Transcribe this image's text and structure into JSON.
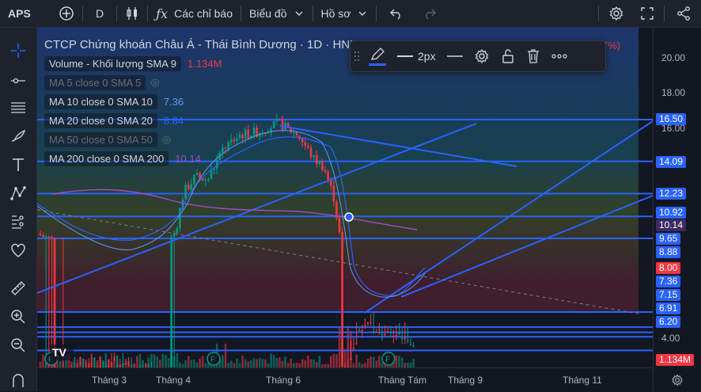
{
  "topbar": {
    "symbol": "APS",
    "interval": "D",
    "indicators_label": "Các chỉ báo",
    "layout_label": "Biểu đồ",
    "profile_label": "Hồ sơ"
  },
  "sidebar": {
    "tools": [
      "crosshair-icon",
      "horizontal-ray-icon",
      "lines-icon",
      "brush-icon",
      "text-icon",
      "pattern-icon",
      "prediction-icon",
      "heart-icon",
      "ruler-icon",
      "zoom-in-icon",
      "zoom-out-icon",
      "magnet-icon"
    ]
  },
  "legend": {
    "title": "CTCP Chứng khoán Châu Á - Thái Bình Dương · 1D · HNX",
    "change": "7%)",
    "volume_label": "Volume - Khối lượng SMA 9",
    "volume_value": "1.134M",
    "ma5_label": "MA 5 close 0 SMA 5",
    "ma10_label": "MA 10 close 0 SMA 10",
    "ma10_value": "7.36",
    "ma20_label": "MA 20 close 0 SMA 20",
    "ma20_value": "8.84",
    "ma50_label": "MA 50 close 0 SMA 50",
    "ma200_label": "MA 200 close 0 SMA 200",
    "ma200_value": "10.14"
  },
  "floatbar": {
    "width_label": "2px"
  },
  "price_axis": {
    "ticks": [
      "20.00",
      "18.00",
      "16.00",
      "4.00"
    ],
    "labels": [
      {
        "text": "16.50",
        "color": "#2962ff"
      },
      {
        "text": "14.09",
        "color": "#2962ff"
      },
      {
        "text": "12.23",
        "color": "#2962ff"
      },
      {
        "text": "10.92",
        "color": "#2962ff"
      },
      {
        "text": "10.14",
        "color": "#3d2a63"
      },
      {
        "text": "9.65",
        "color": "#2962ff"
      },
      {
        "text": "8.88",
        "color": "#2962ff"
      },
      {
        "text": "8.00",
        "color": "#f23645"
      },
      {
        "text": "7.36",
        "color": "#2962ff"
      },
      {
        "text": "7.15",
        "color": "#2962ff"
      },
      {
        "text": "6.91",
        "color": "#2962ff"
      },
      {
        "text": "6.20",
        "color": "#2962ff"
      },
      {
        "text": "1.134M",
        "color": "#f23645"
      }
    ]
  },
  "time_axis": {
    "ticks": [
      "Tháng 3",
      "Tháng 4",
      "Tháng 6",
      "Tháng Tám",
      "Tháng 9",
      "Tháng 11"
    ]
  },
  "chart_data": {
    "type": "candlestick",
    "horizontal_levels": [
      16.5,
      14.09,
      12.23,
      10.92,
      9.65,
      8.88,
      8.0,
      7.36,
      7.15,
      6.91,
      6.2
    ],
    "last_close": 8.0,
    "ma10": 7.36,
    "ma20": 8.84,
    "ma200": 10.14
  }
}
